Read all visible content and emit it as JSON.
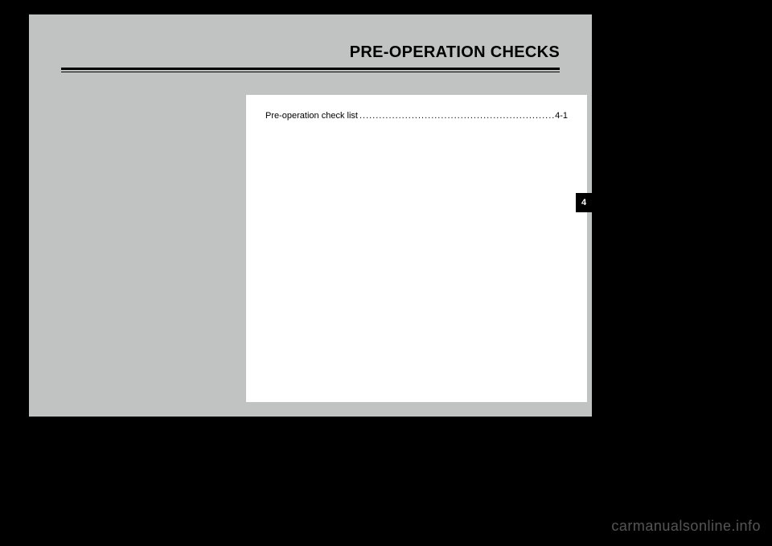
{
  "header": {
    "title": "PRE-OPERATION CHECKS"
  },
  "toc": {
    "items": [
      {
        "label": "Pre-operation check list",
        "dots": ".......................................................................",
        "page": "4-1"
      }
    ]
  },
  "tab": {
    "number": "4"
  },
  "watermark": {
    "text": "carmanualsonline.info"
  }
}
